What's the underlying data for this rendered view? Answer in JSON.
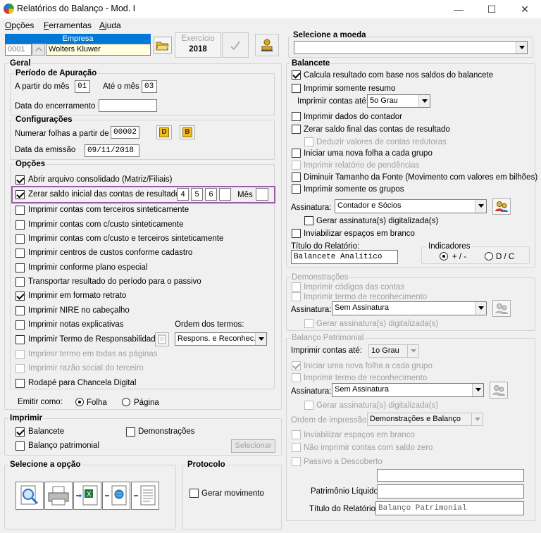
{
  "window": {
    "title": "Relatórios do Balanço - Mod. I",
    "minimize": "—",
    "maximize": "☐",
    "close": "✕"
  },
  "menu": [
    "Opções",
    "Ferramentas",
    "Ajuda"
  ],
  "empresa": {
    "label": "Empresa",
    "code": "0001",
    "name": "Wolters Kluwer",
    "exercicio_label": "Exercício",
    "exercicio_value": "2018"
  },
  "geral": {
    "title": "Geral",
    "periodo": {
      "title": "Período de Apuração",
      "a_partir_label": "A partir do mês",
      "a_partir_value": "01",
      "ate_label": "Até o mês",
      "ate_value": "03",
      "encerramento_label": "Data do encerramento",
      "encerramento_value": ""
    },
    "config": {
      "title": "Configurações",
      "numerar_label": "Numerar folhas a partir de",
      "numerar_value": "00002",
      "btn_d": "D",
      "btn_b": "B",
      "emissao_label": "Data da emissão",
      "emissao_value": "09/11/2018"
    },
    "opcoes": {
      "title": "Opções",
      "abrir": "Abrir arquivo consolidado (Matriz/Filiais)",
      "zerar": "Zerar saldo inicial das contas de resultado",
      "zerar_vals": [
        "4",
        "5",
        "6",
        ""
      ],
      "mes_label": "Mês",
      "mes_value": "",
      "items": [
        {
          "label": "Imprimir contas com terceiros sinteticamente",
          "checked": false,
          "disabled": false
        },
        {
          "label": "Imprimir contas com c/custo sinteticamente",
          "checked": false,
          "disabled": false
        },
        {
          "label": "Imprimir contas com c/custo e terceiros sinteticamente",
          "checked": false,
          "disabled": false
        },
        {
          "label": "Imprimir centros de custos conforme cadastro",
          "checked": false,
          "disabled": false
        },
        {
          "label": "Imprimir conforme plano especial",
          "checked": false,
          "disabled": false
        },
        {
          "label": "Transportar resultado do período para o passivo",
          "checked": false,
          "disabled": false
        },
        {
          "label": "Imprimir em formato retrato",
          "checked": true,
          "disabled": false
        },
        {
          "label": "Imprimir NIRE no cabeçalho",
          "checked": false,
          "disabled": false
        },
        {
          "label": "Imprimir notas explicativas",
          "checked": false,
          "disabled": false
        },
        {
          "label": "Imprimir Termo de Responsabilidade",
          "checked": false,
          "disabled": false
        },
        {
          "label": "Imprimir termo em todas as páginas",
          "checked": false,
          "disabled": true
        },
        {
          "label": "Imprimir razão social do terceiro",
          "checked": false,
          "disabled": true
        },
        {
          "label": "Rodapé para Chancela Digital",
          "checked": false,
          "disabled": false
        }
      ],
      "ordem_label": "Ordem dos termos:",
      "ordem_value": "Respons. e Reconhec."
    },
    "emitir": {
      "label": "Emitir como:",
      "folha": "Folha",
      "pagina": "Página"
    }
  },
  "imprimir": {
    "title": "Imprimir",
    "balancete": "Balancete",
    "demonstracoes": "Demonstrações",
    "patrimonial": "Balanço patrimonial",
    "selecionar": "Selecionar"
  },
  "selecione_opcao": {
    "title": "Selecione a opção"
  },
  "protocolo": {
    "title": "Protocolo",
    "gerar": "Gerar movimento"
  },
  "moeda": {
    "title": "Selecione a moeda",
    "value": ""
  },
  "balancete": {
    "title": "Balancete",
    "calcula": "Calcula resultado com base nos saldos do balancete",
    "resumo": "Imprimir somente resumo",
    "contas_ate_label": "Imprimir contas até:",
    "contas_ate_value": "5o Grau",
    "contador": "Imprimir dados do contador",
    "zerar_final": "Zerar saldo final das contas de resultado",
    "deduzir": "Deduzir valores de contas redutoras",
    "nova_folha": "Iniciar uma nova folha a cada grupo",
    "pendencias": "Imprimir relatório de pendências",
    "diminuir": "Diminuir Tamanho da Fonte (Movimento com valores em bilhões)",
    "grupos": "Imprimir somente os grupos",
    "assinatura_label": "Assinatura:",
    "assinatura_value": "Contador e Sócios",
    "gerar_dig": "Gerar assinatura(s) digitalizada(s)",
    "inviabilizar": "Inviabilizar espaços em branco",
    "titulo_label": "Título do Relatório:",
    "titulo_value": "Balancete Analítico",
    "indicadores_title": "Indicadores",
    "ind_1": "+ / -",
    "ind_2": "D / C"
  },
  "demonstracoes": {
    "title": "Demonstrações",
    "codigos": "Imprimir códigos das contas",
    "termo": "Imprimir termo de reconhecimento",
    "assinatura_label": "Assinatura:",
    "assinatura_value": "Sem Assinatura",
    "gerar_dig": "Gerar assinatura(s) digitalizada(s)"
  },
  "patrimonial": {
    "title": "Balanço Patrimonial",
    "contas_ate_label": "Imprimir contas até:",
    "contas_ate_value": "1o Grau",
    "nova_folha": "Iniciar uma nova folha a cada grupo",
    "termo": "Imprimir termo de reconhecimento",
    "assinatura_label": "Assinatura:",
    "assinatura_value": "Sem Assinatura",
    "gerar_dig": "Gerar assinatura(s) digitalizada(s)",
    "ordem_label": "Ordem de impressão:",
    "ordem_value": "Demonstrações e Balanço",
    "inviabilizar": "Inviabilizar espaços em branco",
    "nao_imprimir": "Não imprimir contas com saldo zero",
    "passivo": "Passivo a Descoberto",
    "pl_label": "Patrimônio Líquido",
    "titulo_label": "Título do Relatório:",
    "titulo_value": "Balanço Patrimonial"
  },
  "colors": {
    "highlight": "#9b5aa6",
    "empresa_header": "#0078d7",
    "empresa_name_bg": "#ffffe1"
  }
}
